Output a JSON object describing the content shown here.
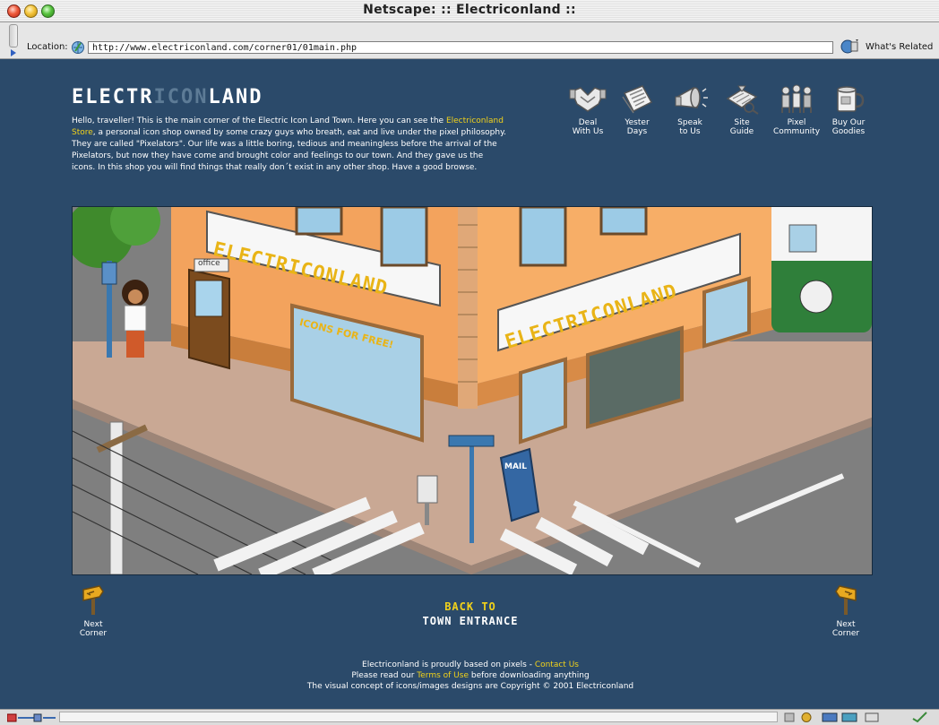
{
  "window": {
    "title": "Netscape: :: Electriconland ::"
  },
  "toolbar": {
    "location_label": "Location:",
    "url": "http://www.electriconland.com/corner01/01main.php",
    "whats_related": "What's Related"
  },
  "logo": {
    "part1": "ELECTR",
    "part2": "ICON",
    "part3": "LAND"
  },
  "intro": {
    "before_link": "Hello, traveller! This is the main corner of the Electric Icon Land Town. Here you can see the ",
    "link": "Electriconland Store",
    "after_link": ", a personal icon shop owned by some crazy guys who breath, eat and live under the pixel philosophy. They are called \"Pixelators\". Our life was a little boring, tedious and meaningless before the arrival of the Pixelators, but now they have come and brought color and feelings to our town. And they gave us the icons. In this shop you will find things that really don´t exist in any other shop. Have a good browse."
  },
  "nav": [
    {
      "label": "Deal\nWith Us",
      "icon": "handshake-icon"
    },
    {
      "label": "Yester\nDays",
      "icon": "newspaper-icon"
    },
    {
      "label": "Speak\nto Us",
      "icon": "megaphone-icon"
    },
    {
      "label": "Site\nGuide",
      "icon": "map-icon"
    },
    {
      "label": "Pixel\nCommunity",
      "icon": "people-icon"
    },
    {
      "label": "Buy Our\nGoodies",
      "icon": "mug-icon"
    }
  ],
  "scene": {
    "sign_text": "ELECTRICONLAND",
    "office_sign": "office",
    "window_text": "ICONS FOR FREE!",
    "mail_text": "MAIL"
  },
  "corners": {
    "left_label": "Next\nCorner",
    "right_label": "Next\nCorner"
  },
  "back": {
    "line1": "BACK TO",
    "line2": "TOWN ENTRANCE"
  },
  "footer": {
    "line1_text": "Electriconland is proudly based on pixels - ",
    "line1_link": "Contact Us",
    "line2_before": "Please read our ",
    "line2_link": "Terms of Use",
    "line2_after": " before downloading anything",
    "line3": "The visual concept of icons/images designs are Copyright © 2001 Electriconland"
  },
  "colors": {
    "page_bg": "#2b4a6a",
    "link_yellow": "#f2d21a",
    "logo_mid": "#5d7b96"
  }
}
